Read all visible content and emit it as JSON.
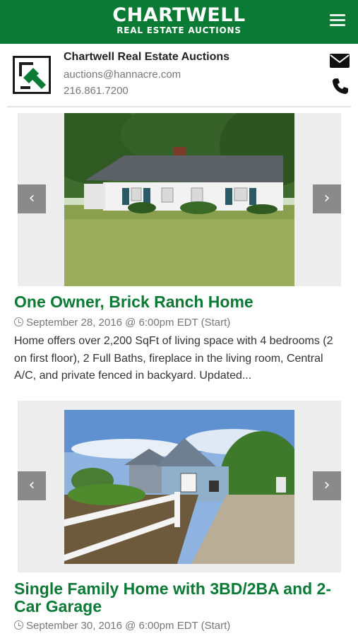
{
  "header": {
    "brand_main": "CHARTWELL",
    "brand_sub": "REAL ESTATE AUCTIONS",
    "menu_icon": "hamburger-menu-icon",
    "bg_color": "#0b7a35"
  },
  "contact": {
    "company": "Chartwell Real Estate Auctions",
    "email": "auctions@hannacre.com",
    "phone": "216.861.7200",
    "mail_icon": "envelope-icon",
    "phone_icon": "phone-icon",
    "logo_icon": "gavel-logo-icon"
  },
  "listings": [
    {
      "title": "One Owner, Brick Ranch Home",
      "date": "September 28, 2016 @ 6:00pm EDT (Start)",
      "description": "Home offers over 2,200 SqFt of living space with 4 bedrooms (2 on first floor), 2 Full Baths, fireplace in the living room, Central A/C, and private fenced in backyard. Updated...",
      "prev_label": "‹",
      "next_label": "›"
    },
    {
      "title": "Single Family Home with 3BD/2BA and 2-Car Garage",
      "date": "September 30, 2016 @ 6:00pm EDT (Start)",
      "prev_label": "‹",
      "next_label": "›"
    }
  ],
  "colors": {
    "accent": "#0b7a35",
    "arrow": "#8a8a8a",
    "muted_text": "#777777"
  }
}
